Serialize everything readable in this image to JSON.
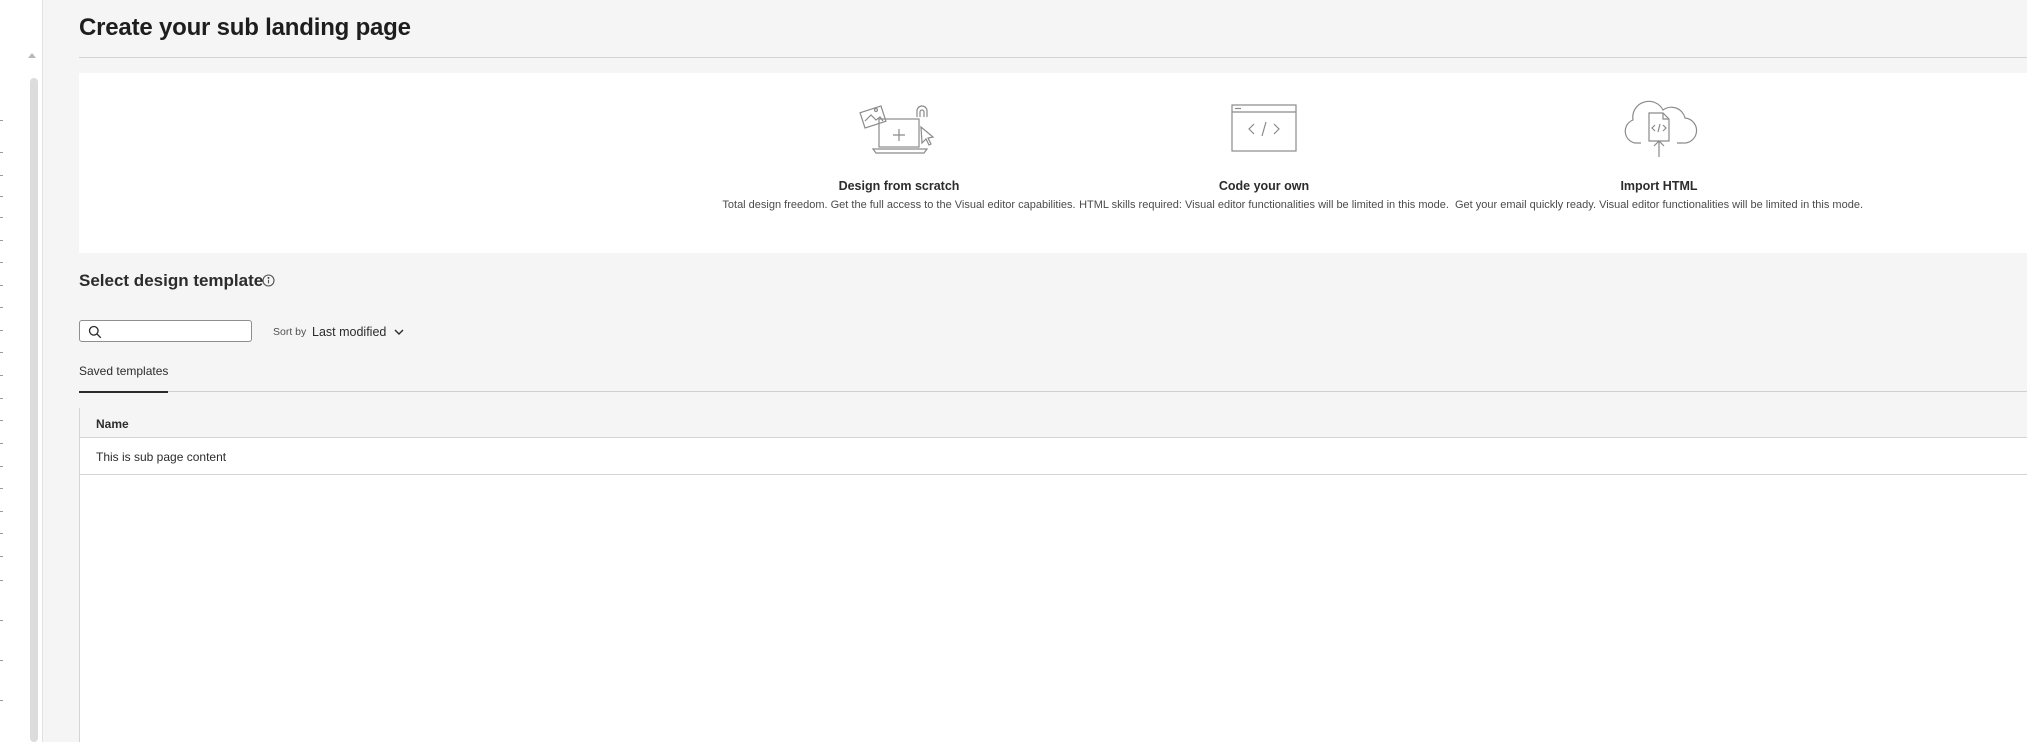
{
  "page": {
    "title": "Create your sub landing page"
  },
  "options": [
    {
      "title": "Design from scratch",
      "description": "Total design freedom. Get the full access to the Visual editor capabilities.",
      "icon": "design-from-scratch-icon"
    },
    {
      "title": "Code your own",
      "description": "HTML skills required: Visual editor functionalities will be limited in this mode.",
      "icon": "code-window-icon"
    },
    {
      "title": "Import HTML",
      "description": "Get your email quickly ready. Visual editor functionalities will be limited in this mode.",
      "icon": "cloud-upload-icon"
    }
  ],
  "templates": {
    "section_title": "Select design template",
    "search": {
      "value": "",
      "placeholder": ""
    },
    "sort": {
      "label": "Sort by",
      "selected": "Last modified"
    },
    "tabs": [
      {
        "label": "Saved templates",
        "active": true
      }
    ],
    "table": {
      "columns": [
        "Name"
      ],
      "rows": [
        {
          "name": "This is sub page content"
        }
      ]
    }
  },
  "colors": {
    "background": "#f5f5f5",
    "panel": "#ffffff",
    "text": "#2c2c2c",
    "border": "#d4d4d4",
    "icon_stroke": "#8a8a8a"
  }
}
